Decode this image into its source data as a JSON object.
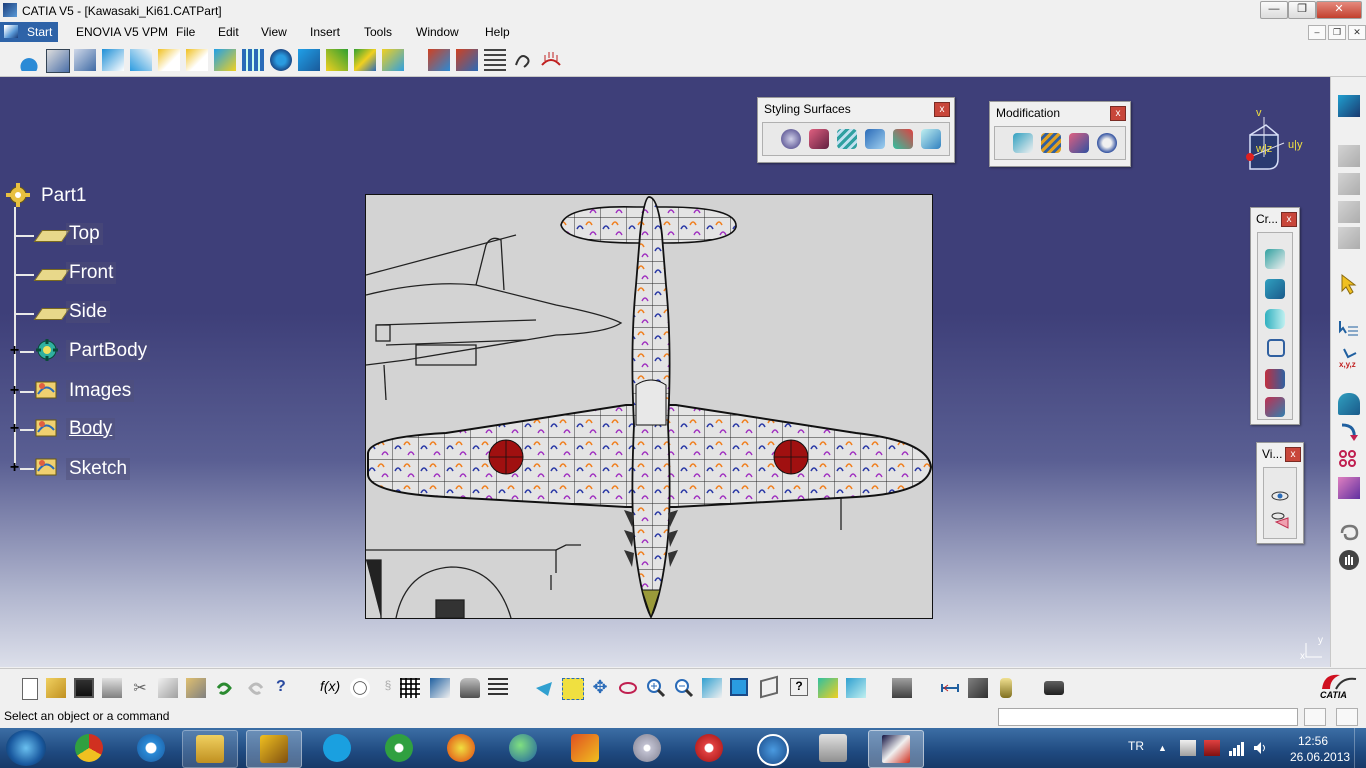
{
  "window": {
    "title": "CATIA V5 - [Kawasaki_Ki61.CATPart]",
    "minimize": "—",
    "restore": "❐",
    "close": "✕"
  },
  "menu": {
    "start": "Start",
    "items": [
      "ENOVIA V5 VPM",
      "File",
      "Edit",
      "View",
      "Insert",
      "Tools",
      "Window",
      "Help"
    ],
    "mdi_min": "–",
    "mdi_restore": "❐",
    "mdi_close": "✕"
  },
  "tree": {
    "root": "Part1",
    "items": [
      {
        "label": "Top",
        "kind": "plane"
      },
      {
        "label": "Front",
        "kind": "plane"
      },
      {
        "label": "Side",
        "kind": "plane"
      },
      {
        "label": "PartBody",
        "kind": "body",
        "expandable": true
      },
      {
        "label": "Images",
        "kind": "set",
        "expandable": true
      },
      {
        "label": "Body",
        "kind": "set",
        "expandable": true
      },
      {
        "label": "Sketch",
        "kind": "set",
        "expandable": true
      }
    ],
    "plus": "+"
  },
  "floating_toolbars": {
    "styling": {
      "title": "Styling Surfaces",
      "close": "x"
    },
    "modification": {
      "title": "Modification",
      "close": "x"
    },
    "create": {
      "title": "Cr...",
      "close": "x"
    },
    "view": {
      "title": "Vi...",
      "close": "x"
    }
  },
  "compass": {
    "v": "v",
    "u": "u|y",
    "w": "w|z"
  },
  "axis_corner": {
    "x": "x",
    "y": "y"
  },
  "brand": {
    "logo_text": "CATIA"
  },
  "status": {
    "message": "Select an object or a command",
    "input_value": ""
  },
  "taskbar": {
    "language": "TR",
    "time": "12:56",
    "date": "26.06.2013",
    "apps": [
      "start-orb",
      "chrome",
      "internet-explorer",
      "file-explorer",
      "catia-launcher",
      "skype",
      "utorrent",
      "burning-tool",
      "globe-app",
      "paint-app",
      "dvd-app",
      "media-player",
      "thunder-app",
      "calculator",
      "catia-active"
    ]
  },
  "colors": {
    "viewport_top": "#3e3f79",
    "viewport_bottom": "#dcdfea",
    "hinomaru": "#a01010",
    "taskbar": "#1f4a80"
  }
}
